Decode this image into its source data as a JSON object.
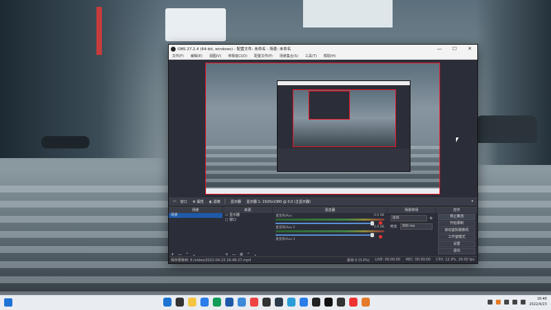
{
  "window": {
    "title": "OBS 27.2.4 (64-bit, windows) - 配置文件: 未命名 - 场景: 未命名",
    "controls": [
      "—",
      "☐",
      "✕"
    ]
  },
  "menu": [
    "文件(F)",
    "编辑(E)",
    "视图(V)",
    "停靠窗口(D)",
    "配置文件(P)",
    "场景集合(S)",
    "工具(T)",
    "帮助(H)"
  ],
  "control_strip": {
    "source_label": "窗口",
    "properties": "属性",
    "filters": "滤镜",
    "display": "显示器",
    "display_value": "显示器 1: 1920x1080 @ 0,0 (主显示器)"
  },
  "docks": {
    "scenes": {
      "title": "场景",
      "items": [
        "场景"
      ]
    },
    "sources": {
      "title": "来源",
      "items": [
        "显示器",
        "窗口"
      ]
    },
    "mixer": {
      "title": "混音器",
      "tracks": [
        {
          "name": "麦克风/Aux",
          "level": "0.0 dB"
        },
        {
          "name": "麦克风/Aux 2",
          "level": "0.0 dB"
        },
        {
          "name": "麦克风/Aux 3",
          "level": ""
        }
      ]
    },
    "transitions": {
      "title": "场景转场",
      "type": "淡出",
      "duration_label": "时长",
      "duration": "300 ms"
    },
    "controls": {
      "title": "控件",
      "buttons": [
        "停止推流",
        "开始录制",
        "启动虚拟摄像机",
        "工作室模式",
        "设置",
        "退出"
      ]
    }
  },
  "statusbar": {
    "recording_file": "保存录像到: E:/video/2022-04-23 16-48-27.mp4",
    "dropped": "丢帧 0 (0.0%)",
    "live": "LIVE: 00:00:00",
    "rec": "REC: 00:00:00",
    "cpu": "CPU: 12.9%, 30.00 fps"
  },
  "taskbar": {
    "time": "16:48",
    "date": "2022/4/23",
    "icon_colors": [
      "#1e73d4",
      "#333",
      "#f5c542",
      "#2b7de9",
      "#0f9d58",
      "#1e5aa8",
      "#3c8ad8",
      "#e44",
      "#333",
      "#2b3a4a",
      "#2a9dd8",
      "#2b7de9",
      "#222",
      "#111",
      "#333",
      "#e33",
      "#e37b2a"
    ]
  }
}
